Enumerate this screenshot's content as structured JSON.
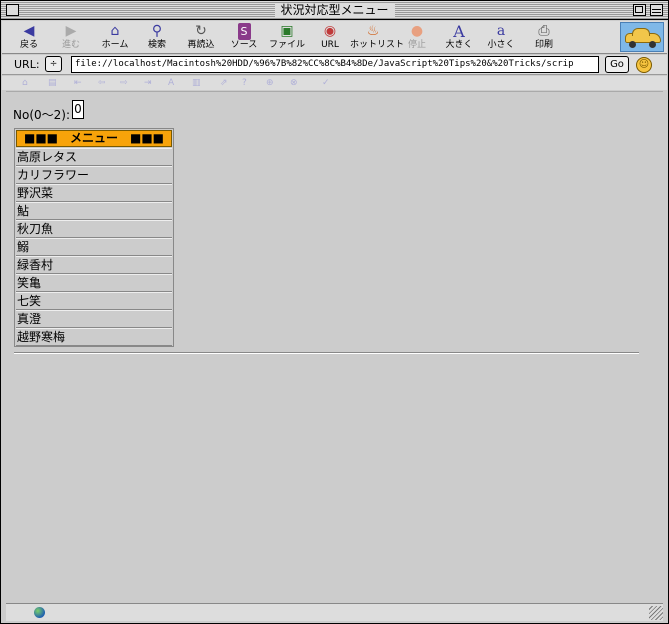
{
  "window": {
    "title": "状況対応型メニュー"
  },
  "toolbar": {
    "buttons": [
      {
        "label": "戻る",
        "icon": "back-arrow-icon",
        "glyph": "◀",
        "enabled": true
      },
      {
        "label": "進む",
        "icon": "forward-arrow-icon",
        "glyph": "▶",
        "enabled": false
      },
      {
        "label": "ホーム",
        "icon": "home-icon",
        "glyph": "⌂",
        "enabled": true
      },
      {
        "label": "検索",
        "icon": "search-icon",
        "glyph": "⚲",
        "enabled": true
      },
      {
        "label": "再読込",
        "icon": "reload-icon",
        "glyph": "↻",
        "enabled": true
      },
      {
        "label": "ソース",
        "icon": "source-icon",
        "glyph": "S",
        "enabled": true
      },
      {
        "label": "ファイル",
        "icon": "file-icon",
        "glyph": "▣",
        "enabled": true
      },
      {
        "label": "URL",
        "icon": "url-globe-icon",
        "glyph": "◉",
        "enabled": true
      },
      {
        "label": "ホットリスト",
        "icon": "hotlist-icon",
        "glyph": "♨",
        "enabled": true
      },
      {
        "label": "停止",
        "icon": "stop-icon",
        "glyph": "●",
        "enabled": false
      },
      {
        "label": "大きく",
        "icon": "larger-text-icon",
        "glyph": "A",
        "enabled": true
      },
      {
        "label": "小さく",
        "icon": "smaller-text-icon",
        "glyph": "a",
        "enabled": true
      },
      {
        "label": "印刷",
        "icon": "print-icon",
        "glyph": "⎙",
        "enabled": true
      }
    ]
  },
  "urlbar": {
    "label": "URL:",
    "stepper_glyph": "÷",
    "value": "file://localhost/Macintosh%20HDD/%96%7B%82%CC%8C%B4%8De/JavaScript%20Tips%20&%20Tricks/scrip",
    "go_label": "Go",
    "smiley_glyph": "☺"
  },
  "secondary_toolbar": [
    "⌂",
    "▤",
    "⇤",
    "⇦",
    "⇨",
    "⇥",
    "A",
    "▥",
    "⇗",
    "?",
    "⊕",
    "⊗",
    "✓"
  ],
  "content": {
    "no_label": "No(0〜2):",
    "no_value": "0",
    "menu": {
      "header": "■■■　メニュー　■■■",
      "items": [
        "高原レタス",
        "カリフラワー",
        "野沢菜",
        "鮎",
        "秋刀魚",
        "鰯",
        "緑香村",
        "笑亀",
        "七笑",
        "真澄",
        "越野寒梅"
      ]
    }
  },
  "colors": {
    "menu_header_bg": "#f7a30a",
    "window_bg": "#cccccc"
  }
}
